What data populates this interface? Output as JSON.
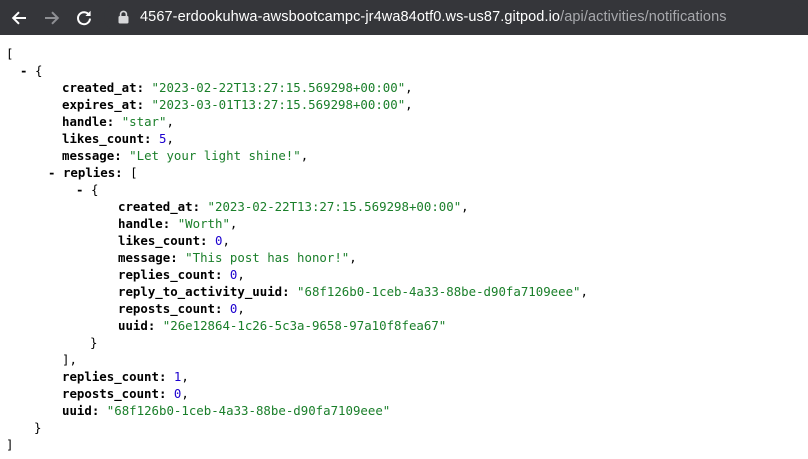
{
  "browser": {
    "url_host": "4567-erdookuhwa-awsbootcampc-jr4wa84otf0.ws-us87.gitpod.io",
    "url_path": "/api/activities/notifications"
  },
  "json": {
    "open_bracket": "[",
    "close_bracket": "]",
    "toggle": "-",
    "open_brace": "{",
    "close_brace": "}",
    "activity": {
      "created_at_key": "created_at:",
      "created_at": "\"2023-02-22T13:27:15.569298+00:00\"",
      "expires_at_key": "expires_at:",
      "expires_at": "\"2023-03-01T13:27:15.569298+00:00\"",
      "handle_key": "handle:",
      "handle": "\"star\"",
      "likes_count_key": "likes_count:",
      "likes_count": "5",
      "message_key": "message:",
      "message": "\"Let your light shine!\"",
      "replies_key": "replies:",
      "replies_open": "[",
      "replies_close": "],",
      "reply": {
        "created_at_key": "created_at:",
        "created_at": "\"2023-02-22T13:27:15.569298+00:00\"",
        "handle_key": "handle:",
        "handle": "\"Worth\"",
        "likes_count_key": "likes_count:",
        "likes_count": "0",
        "message_key": "message:",
        "message": "\"This post has honor!\"",
        "replies_count_key": "replies_count:",
        "replies_count": "0",
        "reply_to_activity_uuid_key": "reply_to_activity_uuid:",
        "reply_to_activity_uuid": "\"68f126b0-1ceb-4a33-88be-d90fa7109eee\"",
        "reposts_count_key": "reposts_count:",
        "reposts_count": "0",
        "uuid_key": "uuid:",
        "uuid": "\"26e12864-1c26-5c3a-9658-97a10f8fea67\""
      },
      "replies_count_key": "replies_count:",
      "replies_count": "1",
      "reposts_count_key": "reposts_count:",
      "reposts_count": "0",
      "uuid_key": "uuid:",
      "uuid": "\"68f126b0-1ceb-4a33-88be-d90fa7109eee\""
    }
  }
}
